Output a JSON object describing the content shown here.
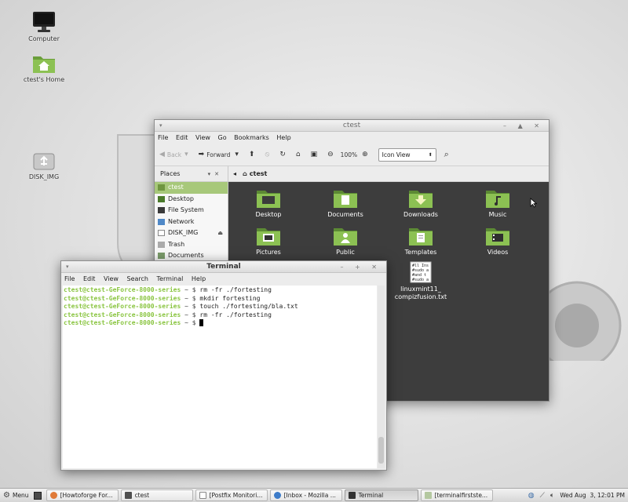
{
  "desktop": {
    "icons": [
      {
        "label": "Computer",
        "icon": "computer-icon"
      },
      {
        "label": "ctest's Home",
        "icon": "home-folder-icon"
      },
      {
        "label": "DISK_IMG",
        "icon": "usb-drive-icon"
      }
    ]
  },
  "file_manager": {
    "title": "ctest",
    "window_buttons": "– ▲ ✕",
    "menu": [
      "File",
      "Edit",
      "View",
      "Go",
      "Bookmarks",
      "Help"
    ],
    "toolbar": {
      "back": "Back",
      "forward": "Forward",
      "zoom": "100%",
      "view_mode": "Icon View"
    },
    "places_label": "Places",
    "path_button": "ctest",
    "sidebar": [
      {
        "label": "ctest",
        "selected": true,
        "color": "#8fb25f"
      },
      {
        "label": "Desktop",
        "color": "#4a7a2a"
      },
      {
        "label": "File System",
        "color": "#3a3a3a"
      },
      {
        "label": "Network",
        "color": "#4f88c7"
      },
      {
        "label": "DISK_IMG",
        "color": "#888888"
      },
      {
        "label": "Trash",
        "color": "#999999"
      },
      {
        "label": "Documents",
        "color": "#7a9a6a"
      }
    ],
    "files": [
      {
        "name": "Desktop",
        "icon": "desktop-folder-icon"
      },
      {
        "name": "Documents",
        "icon": "documents-folder-icon"
      },
      {
        "name": "Downloads",
        "icon": "downloads-folder-icon"
      },
      {
        "name": "Music",
        "icon": "music-folder-icon"
      },
      {
        "name": "Pictures",
        "icon": "pictures-folder-icon"
      },
      {
        "name": "Public",
        "icon": "public-folder-icon"
      },
      {
        "name": "Templates",
        "icon": "templates-folder-icon"
      },
      {
        "name": "Videos",
        "icon": "videos-folder-icon"
      },
      {
        "name": "linuxmint11_\ncompizfusion.txt",
        "icon": "text-file-icon",
        "preview": [
          "#ll Ins",
          "#sudo a",
          "#and t",
          "#sudo a"
        ]
      }
    ]
  },
  "terminal": {
    "title": "Terminal",
    "window_buttons": "– + ✕",
    "menu": [
      "File",
      "Edit",
      "View",
      "Search",
      "Terminal",
      "Help"
    ],
    "prompt": "ctest@ctest-GeForce-8000-series",
    "path": " ~ $ ",
    "lines": [
      "rm -fr ./fortesting",
      "mkdir fortesting",
      "touch ./fortesting/bla.txt",
      "rm -fr ./fortesting",
      ""
    ]
  },
  "taskbar": {
    "menu_label": "Menu",
    "tasks": [
      {
        "label": "[Howtoforge For...",
        "color": "#e07a38"
      },
      {
        "label": "ctest",
        "color": "#4f4f4f"
      },
      {
        "label": "[Postfix Monitori...",
        "color": "#e8e8e8"
      },
      {
        "label": "[Inbox - Mozilla ...",
        "color": "#3d7cc9"
      },
      {
        "label": "Terminal",
        "color": "#333333",
        "active": true
      },
      {
        "label": "[terminalfirstste...",
        "color": "#b4c8a0"
      }
    ],
    "clock": "Wed Aug  3, 12:01 PM"
  }
}
